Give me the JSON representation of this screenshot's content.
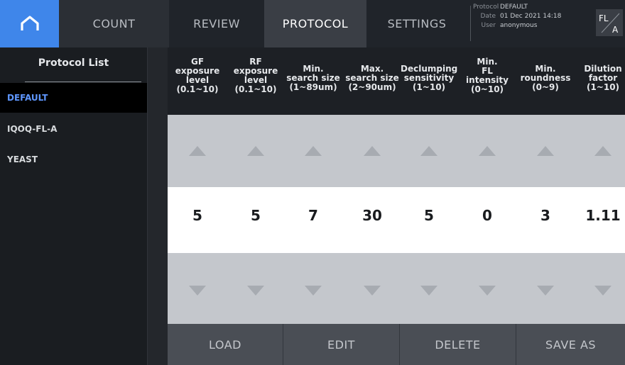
{
  "nav": {
    "tabs": [
      {
        "label": "COUNT"
      },
      {
        "label": "REVIEW"
      },
      {
        "label": "PROTOCOL",
        "active": true
      },
      {
        "label": "SETTINGS"
      }
    ]
  },
  "info": {
    "protocol_key": "Protocol",
    "protocol_val": "DEFAULT",
    "date_key": "Date",
    "date_val": "01 Dec 2021 14:18",
    "user_key": "User",
    "user_val": "anonymous"
  },
  "mode_badge": {
    "top": "FL",
    "bottom": "A"
  },
  "sidebar": {
    "title": "Protocol List",
    "items": [
      {
        "label": "DEFAULT",
        "selected": true
      },
      {
        "label": "IQOQ-FL-A"
      },
      {
        "label": "YEAST"
      }
    ]
  },
  "params": [
    {
      "name": "GF\nexposure\nlevel\n(0.1~10)",
      "value": "5"
    },
    {
      "name": "RF\nexposure\nlevel\n(0.1~10)",
      "value": "5"
    },
    {
      "name": "Min.\nsearch size\n(1~89um)",
      "value": "7"
    },
    {
      "name": "Max.\nsearch size\n(2~90um)",
      "value": "30"
    },
    {
      "name": "Declumping\nsensitivity\n(1~10)",
      "value": "5"
    },
    {
      "name": "Min.\nFL\nintensity\n(0~10)",
      "value": "0"
    },
    {
      "name": "Min.\nroundness\n(0~9)",
      "value": "3"
    },
    {
      "name": "Dilution\nfactor\n(1~10)",
      "value": "1.11"
    }
  ],
  "actions": {
    "load": "LOAD",
    "edit": "EDIT",
    "delete": "DELETE",
    "save_as": "SAVE AS"
  },
  "colors": {
    "accent": "#3f86ea",
    "selected_text": "#5f97ff",
    "arrow_gray": "#a7abb1"
  }
}
